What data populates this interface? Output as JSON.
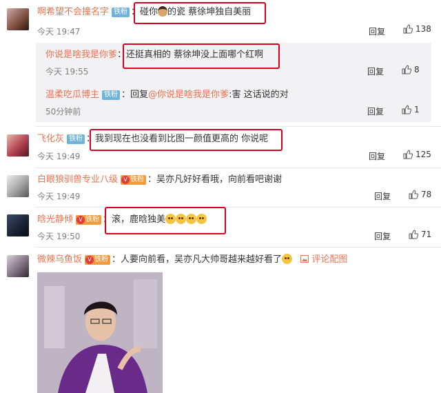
{
  "comments": [
    {
      "user": "啊希望不会撞名字",
      "badge": "铁粉",
      "text_a": "碰你",
      "text_b": "的瓷  蔡徐坤独自美丽",
      "time": "今天 19:47",
      "reply": "回复",
      "likes": "138"
    },
    {
      "user": "飞化灰",
      "badge": "铁粉",
      "text": "我到现在也没看到比图一颜值更高的 你说呢",
      "time": "今天 19:49",
      "reply": "回复",
      "likes": "125"
    },
    {
      "user": "白眼狼驯兽专业八级",
      "badge": "铁粉",
      "text": "吴亦凡好好看哦，向前看吧谢谢",
      "time": "今天 19:49",
      "reply": "回复",
      "likes": "78"
    },
    {
      "user": "晗光静倾",
      "badge": "铁粉",
      "text": "滚，鹿晗独美",
      "time": "今天 19:50",
      "reply": "回复",
      "likes": "71"
    },
    {
      "user": "微辣乌鱼饭",
      "badge": "铁粉",
      "text": "人要向前看，吴亦凡大帅哥越来越好看了",
      "pic_label": "评论配图"
    }
  ],
  "subreplies": [
    {
      "user": "你说是啥我是你爹",
      "text": "还挺真相的 蔡徐坤没上面哪个红啊",
      "time": "今天 19:55",
      "reply": "回复",
      "likes": "8"
    },
    {
      "user": "温柔吃瓜博主",
      "badge": "铁粉",
      "reply_prefix": "回复",
      "mention": "@你说是啥我是你爹",
      "text": ":害 这话说的对",
      "time": "50分钟前",
      "reply": "回复",
      "likes": "1"
    }
  ],
  "vip_mark": "V",
  "colors": {
    "username": "#eb7350",
    "highlight": "#d6001c",
    "badge_blue": "#6fb3d9",
    "badge_orange": "#f29b3a"
  }
}
